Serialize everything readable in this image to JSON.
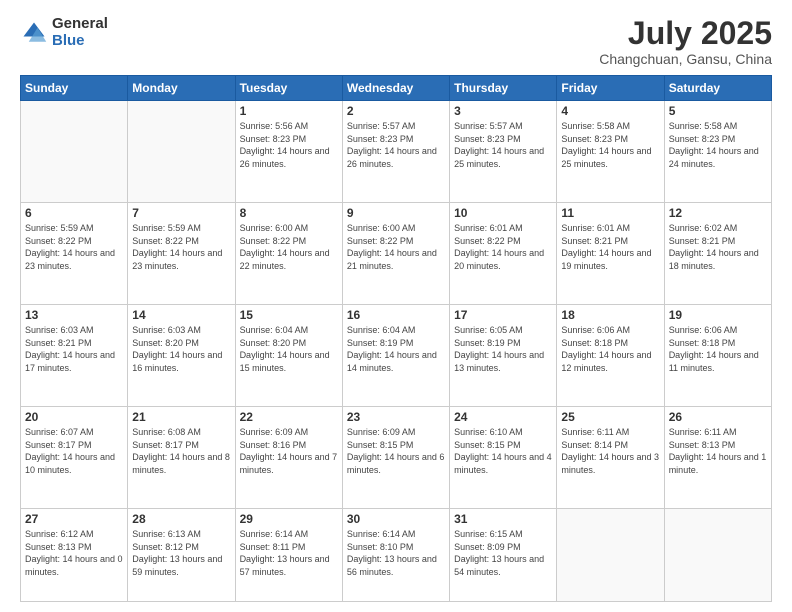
{
  "header": {
    "logo_general": "General",
    "logo_blue": "Blue",
    "month_title": "July 2025",
    "location": "Changchuan, Gansu, China"
  },
  "weekdays": [
    "Sunday",
    "Monday",
    "Tuesday",
    "Wednesday",
    "Thursday",
    "Friday",
    "Saturday"
  ],
  "weeks": [
    [
      {
        "day": "",
        "info": ""
      },
      {
        "day": "",
        "info": ""
      },
      {
        "day": "1",
        "info": "Sunrise: 5:56 AM\nSunset: 8:23 PM\nDaylight: 14 hours and 26 minutes."
      },
      {
        "day": "2",
        "info": "Sunrise: 5:57 AM\nSunset: 8:23 PM\nDaylight: 14 hours and 26 minutes."
      },
      {
        "day": "3",
        "info": "Sunrise: 5:57 AM\nSunset: 8:23 PM\nDaylight: 14 hours and 25 minutes."
      },
      {
        "day": "4",
        "info": "Sunrise: 5:58 AM\nSunset: 8:23 PM\nDaylight: 14 hours and 25 minutes."
      },
      {
        "day": "5",
        "info": "Sunrise: 5:58 AM\nSunset: 8:23 PM\nDaylight: 14 hours and 24 minutes."
      }
    ],
    [
      {
        "day": "6",
        "info": "Sunrise: 5:59 AM\nSunset: 8:22 PM\nDaylight: 14 hours and 23 minutes."
      },
      {
        "day": "7",
        "info": "Sunrise: 5:59 AM\nSunset: 8:22 PM\nDaylight: 14 hours and 23 minutes."
      },
      {
        "day": "8",
        "info": "Sunrise: 6:00 AM\nSunset: 8:22 PM\nDaylight: 14 hours and 22 minutes."
      },
      {
        "day": "9",
        "info": "Sunrise: 6:00 AM\nSunset: 8:22 PM\nDaylight: 14 hours and 21 minutes."
      },
      {
        "day": "10",
        "info": "Sunrise: 6:01 AM\nSunset: 8:22 PM\nDaylight: 14 hours and 20 minutes."
      },
      {
        "day": "11",
        "info": "Sunrise: 6:01 AM\nSunset: 8:21 PM\nDaylight: 14 hours and 19 minutes."
      },
      {
        "day": "12",
        "info": "Sunrise: 6:02 AM\nSunset: 8:21 PM\nDaylight: 14 hours and 18 minutes."
      }
    ],
    [
      {
        "day": "13",
        "info": "Sunrise: 6:03 AM\nSunset: 8:21 PM\nDaylight: 14 hours and 17 minutes."
      },
      {
        "day": "14",
        "info": "Sunrise: 6:03 AM\nSunset: 8:20 PM\nDaylight: 14 hours and 16 minutes."
      },
      {
        "day": "15",
        "info": "Sunrise: 6:04 AM\nSunset: 8:20 PM\nDaylight: 14 hours and 15 minutes."
      },
      {
        "day": "16",
        "info": "Sunrise: 6:04 AM\nSunset: 8:19 PM\nDaylight: 14 hours and 14 minutes."
      },
      {
        "day": "17",
        "info": "Sunrise: 6:05 AM\nSunset: 8:19 PM\nDaylight: 14 hours and 13 minutes."
      },
      {
        "day": "18",
        "info": "Sunrise: 6:06 AM\nSunset: 8:18 PM\nDaylight: 14 hours and 12 minutes."
      },
      {
        "day": "19",
        "info": "Sunrise: 6:06 AM\nSunset: 8:18 PM\nDaylight: 14 hours and 11 minutes."
      }
    ],
    [
      {
        "day": "20",
        "info": "Sunrise: 6:07 AM\nSunset: 8:17 PM\nDaylight: 14 hours and 10 minutes."
      },
      {
        "day": "21",
        "info": "Sunrise: 6:08 AM\nSunset: 8:17 PM\nDaylight: 14 hours and 8 minutes."
      },
      {
        "day": "22",
        "info": "Sunrise: 6:09 AM\nSunset: 8:16 PM\nDaylight: 14 hours and 7 minutes."
      },
      {
        "day": "23",
        "info": "Sunrise: 6:09 AM\nSunset: 8:15 PM\nDaylight: 14 hours and 6 minutes."
      },
      {
        "day": "24",
        "info": "Sunrise: 6:10 AM\nSunset: 8:15 PM\nDaylight: 14 hours and 4 minutes."
      },
      {
        "day": "25",
        "info": "Sunrise: 6:11 AM\nSunset: 8:14 PM\nDaylight: 14 hours and 3 minutes."
      },
      {
        "day": "26",
        "info": "Sunrise: 6:11 AM\nSunset: 8:13 PM\nDaylight: 14 hours and 1 minute."
      }
    ],
    [
      {
        "day": "27",
        "info": "Sunrise: 6:12 AM\nSunset: 8:13 PM\nDaylight: 14 hours and 0 minutes."
      },
      {
        "day": "28",
        "info": "Sunrise: 6:13 AM\nSunset: 8:12 PM\nDaylight: 13 hours and 59 minutes."
      },
      {
        "day": "29",
        "info": "Sunrise: 6:14 AM\nSunset: 8:11 PM\nDaylight: 13 hours and 57 minutes."
      },
      {
        "day": "30",
        "info": "Sunrise: 6:14 AM\nSunset: 8:10 PM\nDaylight: 13 hours and 56 minutes."
      },
      {
        "day": "31",
        "info": "Sunrise: 6:15 AM\nSunset: 8:09 PM\nDaylight: 13 hours and 54 minutes."
      },
      {
        "day": "",
        "info": ""
      },
      {
        "day": "",
        "info": ""
      }
    ]
  ]
}
